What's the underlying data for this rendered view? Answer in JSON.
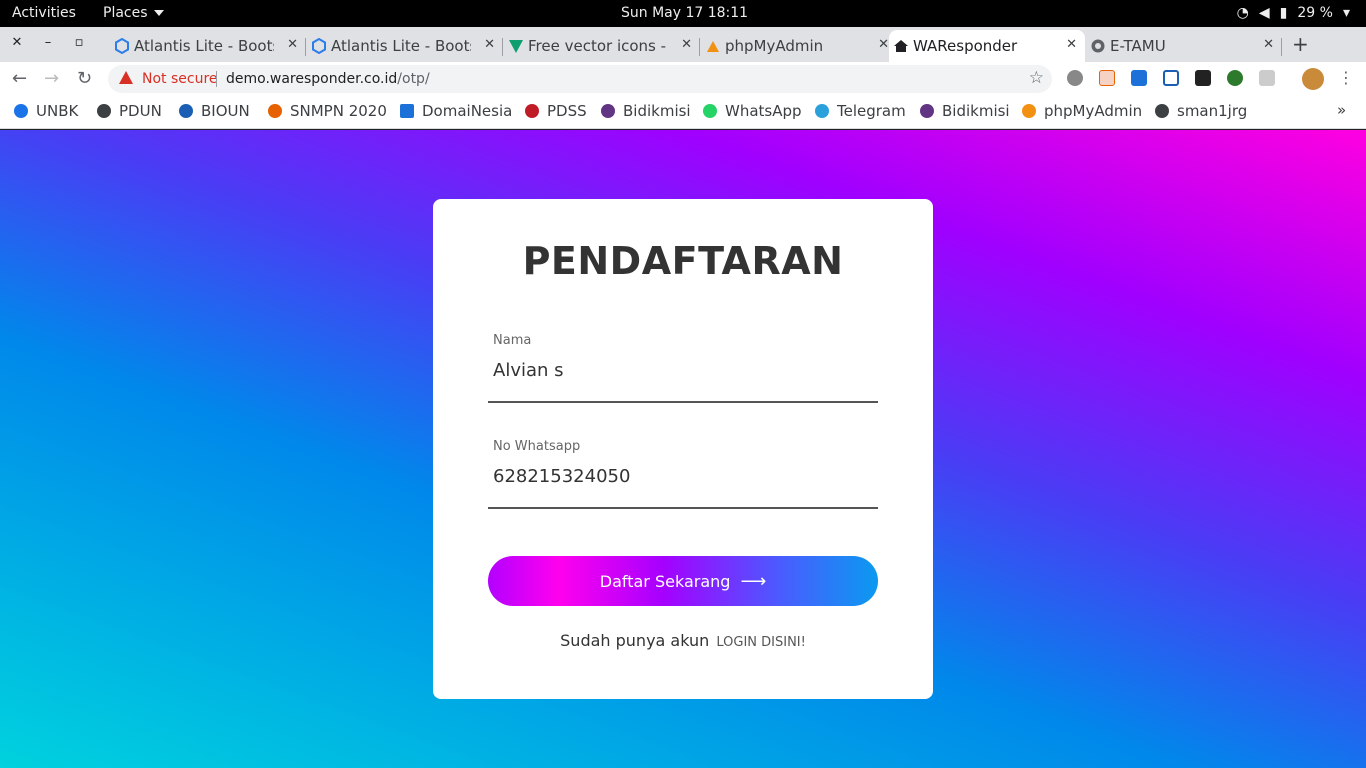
{
  "system": {
    "activities": "Activities",
    "places": "Places",
    "clock": "Sun May 17  18:11",
    "battery": "29 %"
  },
  "tabs": [
    {
      "title": "Atlantis Lite - Bootstrap",
      "icon": "atlantis-icon",
      "color": "#2b7de9"
    },
    {
      "title": "Atlantis Lite - Bootstrap",
      "icon": "atlantis-icon",
      "color": "#2b7de9"
    },
    {
      "title": "Free vector icons - SVG",
      "icon": "flaticon-icon",
      "color": "#0e9f6e"
    },
    {
      "title": "phpMyAdmin",
      "icon": "phpmyadmin-icon",
      "color": "#f29111"
    },
    {
      "title": "WAResponder",
      "icon": "home-icon",
      "color": "#202124"
    },
    {
      "title": "E-TAMU",
      "icon": "globe-icon",
      "color": "#5f6368"
    }
  ],
  "toolbar": {
    "security": "Not secure",
    "url_host": "demo.waresponder.co.id",
    "url_path": "/otp/"
  },
  "bookmarks": [
    {
      "label": "UNBK",
      "color": "#1a73e8"
    },
    {
      "label": "PDUN",
      "color": "#3c4043"
    },
    {
      "label": "BIOUN",
      "color": "#1a5fb4"
    },
    {
      "label": "SNMPN 2020",
      "color": "#e66100"
    },
    {
      "label": "DomaiNesia",
      "color": "#1c71d8"
    },
    {
      "label": "PDSS",
      "color": "#c01c28"
    },
    {
      "label": "Bidikmisi",
      "color": "#613583"
    },
    {
      "label": "WhatsApp",
      "color": "#25d366"
    },
    {
      "label": "Telegram",
      "color": "#2aa1da"
    },
    {
      "label": "Bidikmisi",
      "color": "#613583"
    },
    {
      "label": "phpMyAdmin",
      "color": "#f29111"
    },
    {
      "label": "sman1jrg",
      "color": "#3c4043"
    }
  ],
  "form": {
    "title": "PENDAFTARAN",
    "name_label": "Nama",
    "name_value": "Alvian s",
    "phone_label": "No Whatsapp",
    "phone_value": "628215324050",
    "submit_label": "Daftar Sekarang",
    "login_prompt": "Sudah punya akun",
    "login_link": "LOGIN DISINI!"
  }
}
